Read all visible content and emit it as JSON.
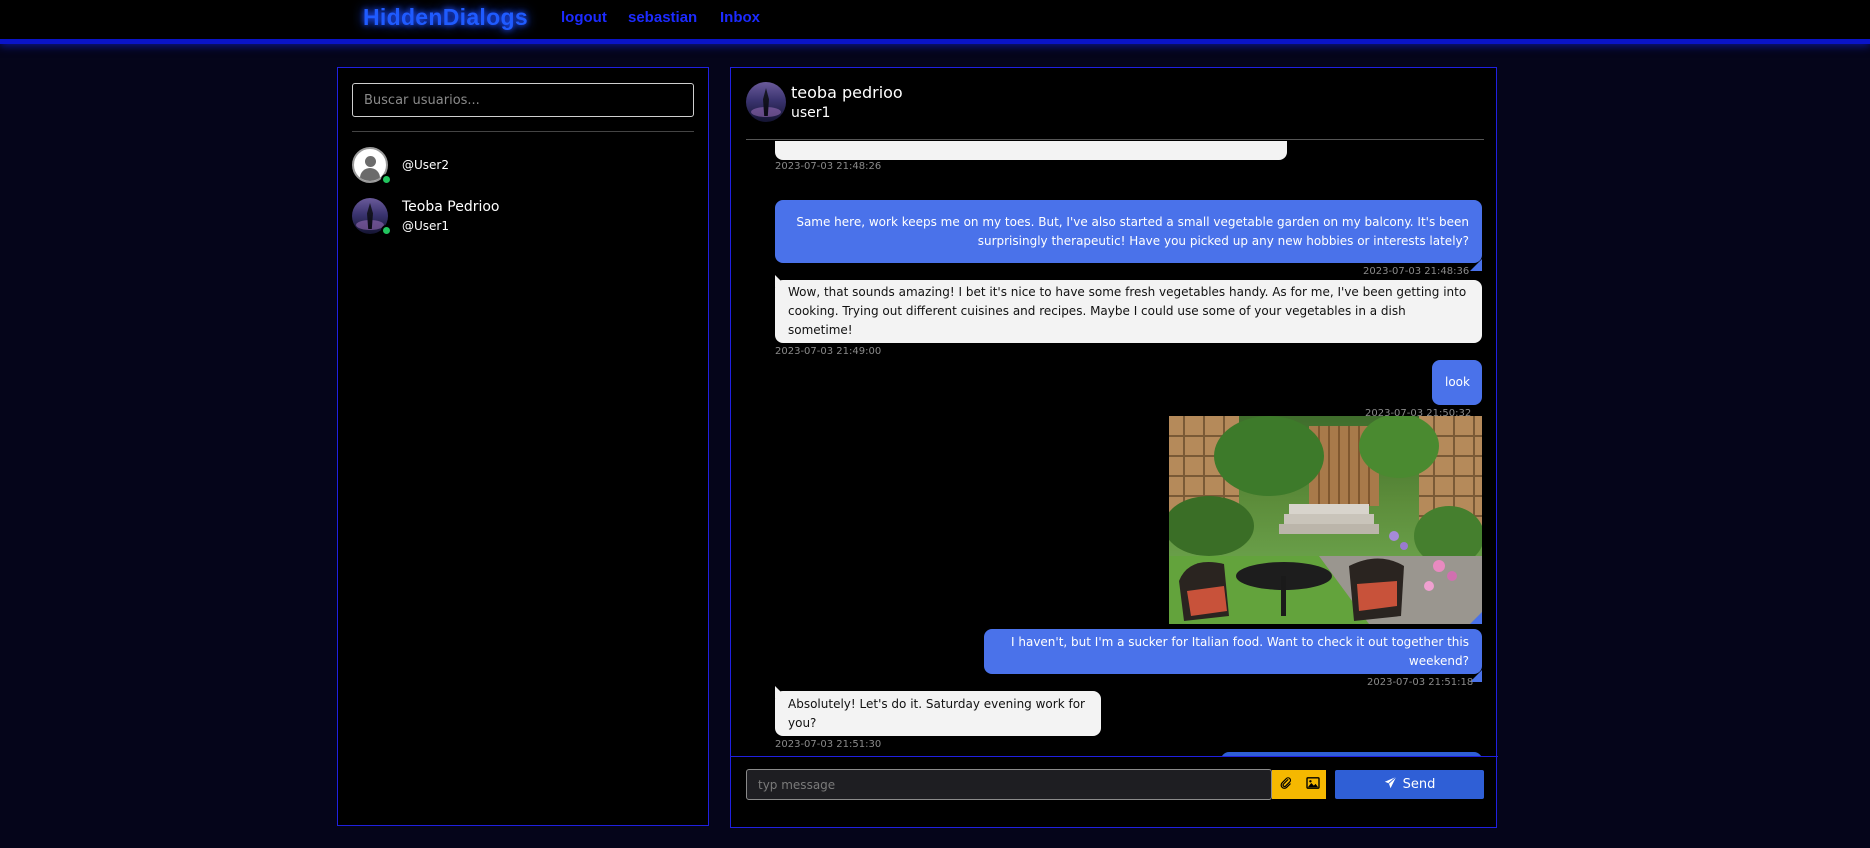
{
  "nav": {
    "brand": "HiddenDialogs",
    "links": [
      "logout",
      "sebastian",
      "Inbox"
    ]
  },
  "sidebar": {
    "search_placeholder": "Buscar usuarios...",
    "users": [
      {
        "name": "",
        "handle": "@User2",
        "online": true,
        "avatar": "default-avatar-icon"
      },
      {
        "name": "Teoba Pedrioo",
        "handle": "@User1",
        "online": true,
        "avatar": "night-tower-photo"
      }
    ]
  },
  "chat": {
    "header": {
      "name": "teoba pedrioo",
      "handle": "user1"
    },
    "messages": [
      {
        "from": "them",
        "text": "",
        "time": "2023-07-03 21:48:26"
      },
      {
        "from": "me",
        "text": "Same here, work keeps me on my toes. But, I've also started a small vegetable garden on my balcony. It's been surprisingly therapeutic! Have you picked up any new hobbies or interests lately?",
        "time": "2023-07-03 21:48:36"
      },
      {
        "from": "them",
        "text": "Wow, that sounds amazing! I bet it's nice to have some fresh vegetables handy. As for me, I've been getting into cooking. Trying out different cuisines and recipes. Maybe I could use some of your vegetables in a dish sometime!",
        "time": "2023-07-03 21:49:00"
      },
      {
        "from": "me",
        "text": "look",
        "time": "2023-07-03 21:50:32"
      },
      {
        "from": "me",
        "type": "image",
        "image": "garden-patio-photo",
        "time": ""
      },
      {
        "from": "me",
        "text": "I haven't, but I'm a sucker for Italian food. Want to check it out together this weekend?",
        "time": "2023-07-03 21:51:18"
      },
      {
        "from": "them",
        "text": "Absolutely! Let's do it. Saturday evening work for you?",
        "time": "2023-07-03 21:51:30"
      }
    ]
  },
  "composer": {
    "placeholder": "typ message",
    "send_label": "Send",
    "attach_icon": "paperclip-icon",
    "image_icon": "image-icon"
  },
  "colors": {
    "accent": "#1f5bff",
    "panel_border": "#2020e0",
    "bubble_out": "#4a72ea",
    "bubble_in": "#f3f3f3",
    "online": "#22c55e",
    "action_yellow": "#f5b800",
    "send_button": "#2f5fd6"
  }
}
